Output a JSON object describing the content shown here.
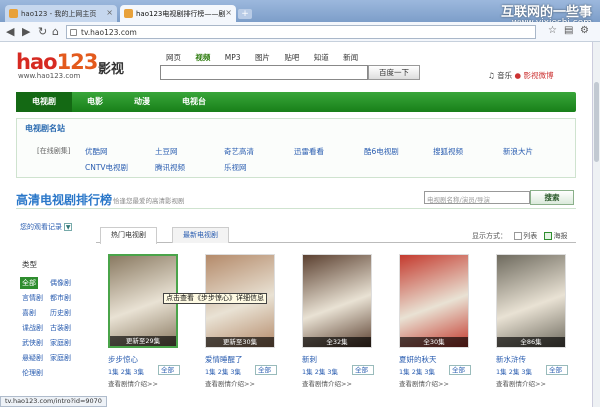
{
  "browser": {
    "tabs": [
      {
        "title": "hao123 - 我的上网主页"
      },
      {
        "title": "hao123电视剧排行榜——剧"
      }
    ],
    "new_tab": "+",
    "url": "tv.hao123.com",
    "watermark": "互联网的一些事",
    "watermark_url": "www.yixieshi.com",
    "status": "tv.hao123.com/intro?id=9070"
  },
  "header": {
    "logo": "hao123",
    "logo_url": "www.hao123.com",
    "section": "影视",
    "search_nav": [
      "网页",
      "视频",
      "MP3",
      "图片",
      "贴吧",
      "知道",
      "新闻"
    ],
    "search_nav_active": "视频",
    "search_value": "",
    "search_button": "百度一下",
    "right_links": [
      "音乐",
      "影视微博"
    ]
  },
  "main_nav": [
    "电视剧",
    "电影",
    "动漫",
    "电视台"
  ],
  "sites": {
    "title": "电视剧名站",
    "label": "[在线剧集]",
    "row1": [
      "优酷网",
      "土豆网",
      "奇艺高清",
      "迅雷看看",
      "酷6电视剧",
      "搜狐视频",
      "新浪大片"
    ],
    "row2": [
      "CNTV电视剧",
      "腾讯视频",
      "乐视网"
    ]
  },
  "ranking": {
    "title": "高清电视剧排行榜",
    "subtitle": "恰逢您最爱的高清影视剧",
    "search_placeholder": "电视剧名称/演员/导演",
    "search_button": "搜索",
    "watch_record": "您的观看记录",
    "genre_title": "类型",
    "genres": [
      "全部",
      "偶像剧",
      "言情剧",
      "都市剧",
      "喜剧",
      "历史剧",
      "谍战剧",
      "古装剧",
      "武侠剧",
      "家庭剧",
      "悬疑剧",
      "家庭剧",
      "伦理剧"
    ],
    "tabs": [
      "热门电视剧",
      "最新电视剧"
    ],
    "display_label": "显示方式：",
    "display_list": "列表",
    "display_poster": "海报",
    "tooltip": "点击查看《步步惊心》详细信息",
    "cards": [
      {
        "title": "步步惊心",
        "ep": "更新至29集",
        "links": "1集 2集 3集",
        "all": "全部",
        "intro": "查看剧情介绍>>",
        "color": "#8a7a62"
      },
      {
        "title": "爱情睡醒了",
        "ep": "更新至30集",
        "links": "1集 2集 3集",
        "all": "全部",
        "intro": "查看剧情介绍>>",
        "color": "#b48a6a"
      },
      {
        "title": "新刺",
        "ep": "全32集",
        "links": "1集 2集 3集",
        "all": "全部",
        "intro": "查看剧情介绍>>",
        "color": "#5b4030"
      },
      {
        "title": "夏妍的秋天",
        "ep": "全30集",
        "links": "1集 2集 3集",
        "all": "全部",
        "intro": "查看剧情介绍>>",
        "color": "#c43a2e"
      },
      {
        "title": "新水浒传",
        "ep": "全86集",
        "links": "1集 2集 3集",
        "all": "全部",
        "intro": "查看剧情介绍>>",
        "color": "#6e6a5e"
      }
    ]
  }
}
